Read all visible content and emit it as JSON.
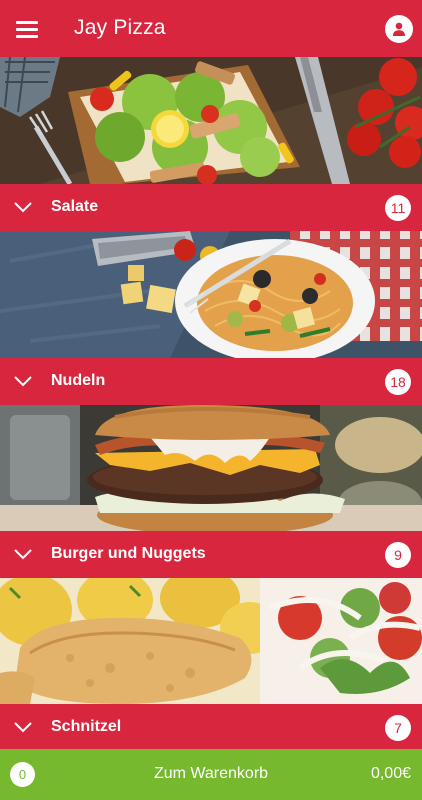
{
  "app_bar": {
    "title": "Jay Pizza",
    "menu_icon": "hamburger-menu-icon",
    "profile_icon": "user-profile-icon",
    "color": "#d8263e"
  },
  "categories": [
    {
      "label": "Salate",
      "count": "11",
      "image": "salad-photo"
    },
    {
      "label": "Nudeln",
      "count": "18",
      "image": "pasta-photo"
    },
    {
      "label": "Burger und Nuggets",
      "count": "9",
      "image": "burger-photo"
    },
    {
      "label": "Schnitzel",
      "count": "7",
      "image": "schnitzel-photo"
    }
  ],
  "cart": {
    "item_count": "0",
    "label": "Zum Warenkorb",
    "total": "0,00€",
    "color": "#76b82e"
  }
}
